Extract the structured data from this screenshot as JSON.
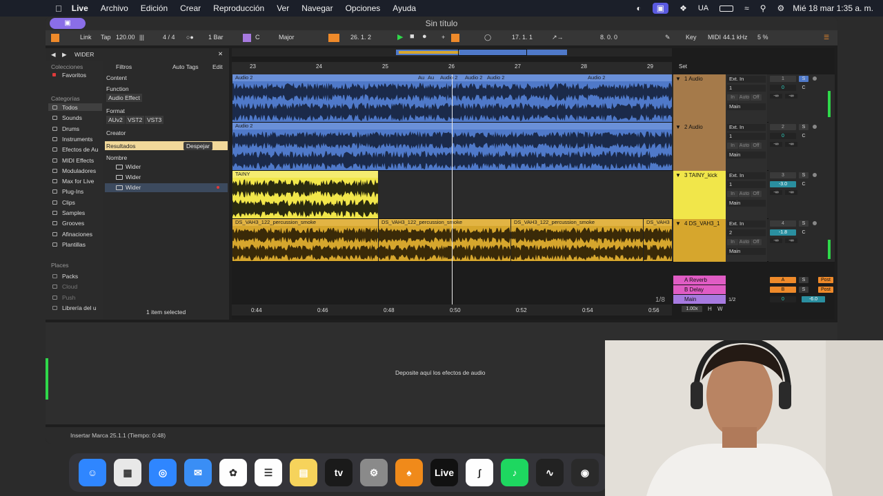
{
  "menubar": {
    "app": "Live",
    "items": [
      "Archivo",
      "Edición",
      "Crear",
      "Reproducción",
      "Ver",
      "Navegar",
      "Opciones",
      "Ayuda"
    ],
    "keyboard": "UA",
    "datetime": "Mié 18 mar  1:35 a. m."
  },
  "window": {
    "title": "Sin título"
  },
  "transport": {
    "link": "Link",
    "tap": "Tap",
    "tempo": "120.00",
    "signature": "4 / 4",
    "quantize": "1 Bar",
    "key": "C",
    "scale": "Major",
    "position": "26.  1.  2",
    "loop_start": "17.  1.  1",
    "loop_length": "8.  0.  0",
    "key_map": "Key",
    "midi_map": "MIDI",
    "sample_rate": "44.1 kHz",
    "cpu": "5 %"
  },
  "browser": {
    "search": "WIDER",
    "collections_header": "Colecciones",
    "favorites": "Favoritos",
    "categories_header": "Categorías",
    "categories": [
      "Todos",
      "Sounds",
      "Drums",
      "Instruments",
      "Efectos de Au",
      "MIDI Effects",
      "Moduladores",
      "Max for Live",
      "Plug-Ins",
      "Clips",
      "Samples",
      "Grooves",
      "Afinaciones",
      "Plantillas"
    ],
    "places_header": "Places",
    "places": [
      "Packs",
      "Cloud",
      "Push",
      "Librería del u"
    ],
    "filters": "Filtros",
    "auto_tags": "Auto Tags",
    "edit": "Edit",
    "content": "Content",
    "function": "Function",
    "audio_effect": "Audio Effect",
    "format": "Format",
    "formats": [
      "AUv2",
      "VST2",
      "VST3"
    ],
    "creator": "Creator",
    "results": "Resultados",
    "clear": "Despejar",
    "name_col": "Nombre",
    "results_items": [
      "Wider",
      "Wider",
      "Wider"
    ],
    "selected_info": "1 item selected"
  },
  "ruler": {
    "bars": [
      "23",
      "24",
      "25",
      "26",
      "27",
      "28",
      "29"
    ],
    "times": [
      "0:44",
      "0:46",
      "0:48",
      "0:50",
      "0:52",
      "0:54",
      "0:56"
    ],
    "set": "Set"
  },
  "tracks": [
    {
      "name": "1 Audio",
      "input": "Ext. In",
      "channel": "1",
      "monitor": [
        "In",
        "Auto",
        "Off"
      ],
      "output": "Main",
      "number": "1",
      "vol": "0",
      "pan": "C",
      "sends": [
        "-∞",
        "-∞"
      ],
      "clips": [
        "Audio 2",
        "Au",
        "Au",
        "Audio 2",
        "Audio 2",
        "Audio 2",
        "Audio 2"
      ]
    },
    {
      "name": "2 Audio",
      "input": "Ext. In",
      "channel": "1",
      "monitor": [
        "In",
        "Auto",
        "Off"
      ],
      "output": "Main",
      "number": "2",
      "vol": "0",
      "pan": "C",
      "sends": [
        "-∞",
        "-∞"
      ],
      "clips": [
        "Audio 2"
      ]
    },
    {
      "name": "3 TAINY_kick",
      "input": "Ext. In",
      "channel": "1",
      "monitor": [
        "In",
        "Auto",
        "Off"
      ],
      "output": "Main",
      "number": "3",
      "vol": "-3.0",
      "pan": "C",
      "sends": [
        "-∞",
        "-∞"
      ],
      "clips": [
        "TAINY"
      ]
    },
    {
      "name": "4 DS_VAH3_1",
      "input": "Ext. In",
      "channel": "2",
      "monitor": [
        "In",
        "Auto",
        "Off"
      ],
      "output": "Main",
      "number": "4",
      "vol": "-1.8",
      "pan": "C",
      "sends": [
        "-∞",
        "-∞"
      ],
      "clips": [
        "DS_VAH3_122_percussion_smoke",
        "DS_VAH3_122_percussion_smoke",
        "DS_VAH3_122_percussion_smoke",
        "DS_VAH3"
      ]
    }
  ],
  "returns": [
    {
      "name": "A Reverb",
      "letter": "A"
    },
    {
      "name": "B Delay",
      "letter": "B"
    },
    {
      "name": "Main",
      "cue": "1/2",
      "vol": "0",
      "vol2": "-6.0"
    }
  ],
  "post": "Post",
  "solo": "S",
  "zoom": "1/8",
  "speed": "1.00x",
  "hw": [
    "H",
    "W"
  ],
  "drop_text": "Deposite aquí los efectos de audio",
  "status": "Insertar Marca 25.1.1 (Tiempo: 0:48)",
  "dock": [
    "Finder",
    "Launchpad",
    "Safari",
    "Mail",
    "Photos",
    "Reminders",
    "Notes",
    "Apple TV",
    "System Settings",
    "FL Studio",
    "Live",
    "Capcut",
    "Spotify",
    "Voice Memos",
    "OBS"
  ],
  "colors": {
    "blue": "#4f79c9",
    "yellow": "#f1e64a",
    "gold": "#d6a62d",
    "brown": "#a57a4a",
    "orange": "#ef8a2a",
    "pink": "#e05cc4",
    "purple": "#a77ae0"
  }
}
